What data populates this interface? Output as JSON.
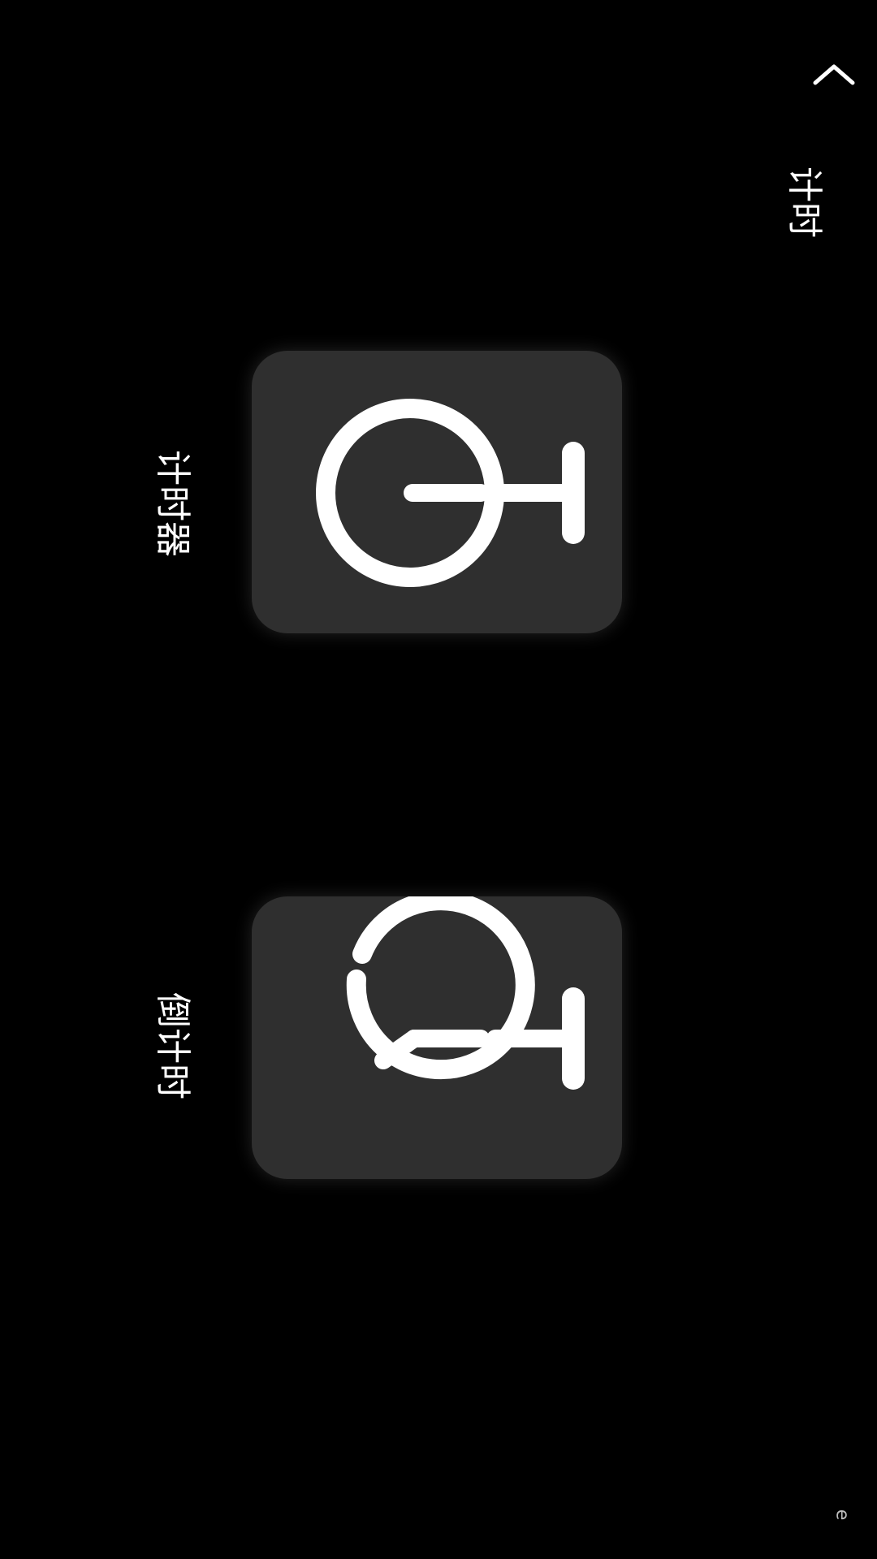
{
  "header": {
    "back_icon": "chevron-up-icon",
    "title": "计时"
  },
  "cards": [
    {
      "key": "timer",
      "label": "计时器",
      "icon": "stopwatch-icon"
    },
    {
      "key": "countdown",
      "label": "倒计时",
      "icon": "timer-icon"
    }
  ],
  "corner_mark": "e",
  "colors": {
    "background": "#000000",
    "card": "#2f2f2f",
    "icon": "#ffffff",
    "text": "#ffffff"
  }
}
